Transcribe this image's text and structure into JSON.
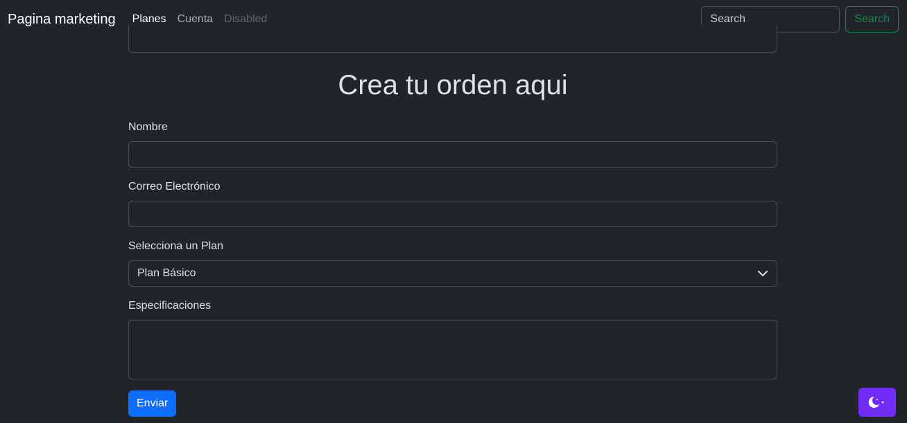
{
  "navbar": {
    "brand": "Pagina marketing",
    "links": [
      {
        "label": "Planes"
      },
      {
        "label": "Cuenta"
      },
      {
        "label": "Disabled"
      }
    ],
    "search": {
      "placeholder": "Search",
      "button_label": "Search"
    }
  },
  "form": {
    "title": "Crea tu orden aqui",
    "fields": {
      "name": {
        "label": "Nombre",
        "value": ""
      },
      "email": {
        "label": "Correo Electrónico",
        "value": ""
      },
      "plan": {
        "label": "Selecciona un Plan",
        "selected": "Plan Básico"
      },
      "specs": {
        "label": "Especificaciones",
        "value": ""
      }
    },
    "submit_label": "Enviar"
  },
  "theme_toggle": {
    "icon": "moon-icon",
    "accent": "#712cf9"
  },
  "colors": {
    "background": "#212529",
    "primary": "#0d6efd",
    "success": "#198754"
  }
}
